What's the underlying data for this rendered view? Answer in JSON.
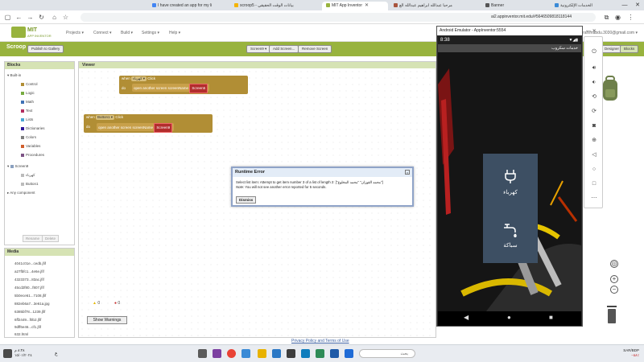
{
  "browser": {
    "tabs": [
      {
        "label": "I have created an app for my li",
        "color": "#4285f4"
      },
      {
        "label": "scroop5 - بيانات الوقت الحقيقي",
        "color": "#f4b400"
      },
      {
        "label": "MIT App Inventor",
        "color": "#98b33e"
      },
      {
        "label": "مرحبا عبدالله ابراهيم عبدالله الع",
        "color": "#a8543d"
      },
      {
        "label": "Banner",
        "color": "#555555"
      },
      {
        "label": "الخدمات الإلكترونية",
        "color": "#3a8ad6"
      }
    ],
    "url": "ai2.appinventor.mit.edu/#5646509818118144",
    "minimize": "—",
    "maximize": "☐",
    "close": "✕"
  },
  "header": {
    "logo_title": "MIT",
    "logo_sub": "APP INVENTOR",
    "menus": [
      "Projects ▾",
      "Connect ▾",
      "Build ▾",
      "Settings ▾",
      "Help ▾"
    ],
    "account": "abdullahibrahimabdu.3030@gmail.com ▾"
  },
  "toolbar": {
    "project_name": "Scroop",
    "publish": "Publish to Gallery",
    "screen_select": "Screen9 ▾",
    "add_screen": "Add Screen...",
    "remove_screen": "Remove Screen",
    "designer": "Designer",
    "blocks": "Blocks"
  },
  "blocks_panel": {
    "title": "Blocks",
    "builtin": "Built-in",
    "builtin_items": [
      {
        "label": "Control",
        "color": "#b18e35"
      },
      {
        "label": "Logic",
        "color": "#77ab41"
      },
      {
        "label": "Math",
        "color": "#3f71b5"
      },
      {
        "label": "Text",
        "color": "#b32d5e"
      },
      {
        "label": "Lists",
        "color": "#49a6d4"
      },
      {
        "label": "Dictionaries",
        "color": "#2d1799"
      },
      {
        "label": "Colors",
        "color": "#7d7d7d"
      },
      {
        "label": "Variables",
        "color": "#d05f2d"
      },
      {
        "label": "Procedures",
        "color": "#7c5385"
      }
    ],
    "screen": "Screen9",
    "components": [
      "كهرباء",
      "Button1"
    ],
    "any_component": "Any component",
    "rename": "Rename",
    "delete": "Delete"
  },
  "media_panel": {
    "title": "Media",
    "items": [
      "4041c01e...cedb.jfif",
      "a27fbfc1...4e6e.jfif",
      "4323373...83ac.jfif",
      "45cd2f80...f807.jfif",
      "5b0ece61...7108.jfif",
      "882eb6a7...3e61a.jpg",
      "6385bf78...1239.jfif",
      "6ff2449...f0b2.jfif",
      "9dff6e46...cf1.jfif",
      "632.html"
    ]
  },
  "viewer": {
    "title": "Viewer",
    "event1": {
      "when": "when",
      "component": "كهرباء ▾",
      "event": "Click",
      "do": "do",
      "command": "open another screen  screenName",
      "screen": "Screen5"
    },
    "event2": {
      "when": "when",
      "component": "Button1 ▾",
      "event": "Click",
      "do": "do",
      "command": "open another screen  screenName",
      "screen": "Screen9"
    },
    "warnings_count": "0",
    "errors_count": "0",
    "show_warnings": "Show Warnings"
  },
  "error_dialog": {
    "title": "Runtime Error",
    "message": "Select list item: Attempt to get item number 3 of a list of length 2: [\"محمد القوزان\" \"محمد المخلوع\"]",
    "note_label": "Note:",
    "note": "You will not see another error reported for 5 seconds.",
    "dismiss": "Dismiss"
  },
  "emulator": {
    "title": "Android Emulator - AppInventor:5554",
    "time": "8:38",
    "app_title": "خدمات سكروب",
    "service1": "كهرباء",
    "service2": "سباكة",
    "panel_color": "#3d4f63"
  },
  "footer": {
    "link": "Privacy Policy and Terms of Use"
  },
  "taskbar": {
    "search": "بحث",
    "clock_time": "٨:٣٨ م",
    "clock_date": "١٥/٠١/٢٠٢٤",
    "lang": "ع",
    "weather_city": "SAR/BDP",
    "weather_change": "−٥٨٪"
  }
}
